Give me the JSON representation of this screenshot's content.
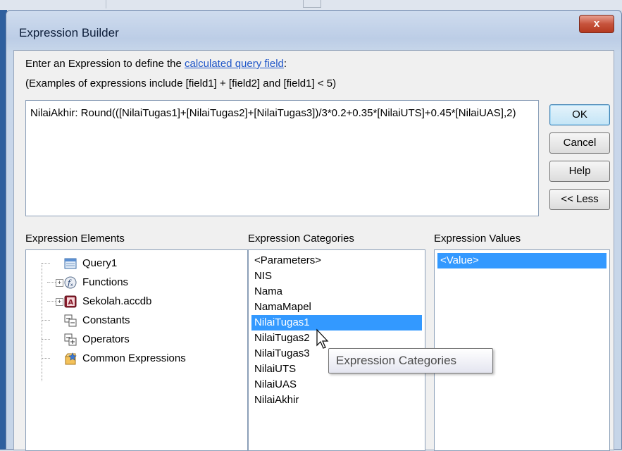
{
  "dialog": {
    "title": "Expression Builder",
    "close_label": "x"
  },
  "prompt": {
    "line1_prefix": "Enter an Expression to define the ",
    "line1_link": "calculated query field",
    "line1_suffix": ":",
    "line2": "(Examples of expressions include [field1] + [field2] and [field1] < 5)"
  },
  "expression": {
    "value": "NilaiAkhir: Round(([NilaiTugas1]+[NilaiTugas2]+[NilaiTugas3])/3*0.2+0.35*[NilaiUTS]+0.45*[NilaiUAS],2)"
  },
  "buttons": {
    "ok": "OK",
    "cancel": "Cancel",
    "help": "Help",
    "less": "<< Less"
  },
  "elements": {
    "label": "Expression Elements",
    "items": [
      {
        "label": "Query1",
        "icon": "query-icon",
        "expandable": false
      },
      {
        "label": "Functions",
        "icon": "function-icon",
        "expandable": true
      },
      {
        "label": "Sekolah.accdb",
        "icon": "database-icon",
        "expandable": true
      },
      {
        "label": "Constants",
        "icon": "constants-icon",
        "expandable": false
      },
      {
        "label": "Operators",
        "icon": "operators-icon",
        "expandable": false
      },
      {
        "label": "Common Expressions",
        "icon": "common-expressions-icon",
        "expandable": false
      }
    ]
  },
  "categories": {
    "label": "Expression Categories",
    "items": [
      "<Parameters>",
      "NIS",
      "Nama",
      "NamaMapel",
      "NilaiTugas1",
      "NilaiTugas2",
      "NilaiTugas3",
      "NilaiUTS",
      "NilaiUAS",
      "NilaiAkhir"
    ],
    "selected": "NilaiTugas1"
  },
  "values": {
    "label": "Expression Values",
    "items": [
      "<Value>"
    ],
    "selected": "<Value>"
  },
  "tooltip": {
    "text": "Expression Categories"
  },
  "colors": {
    "selection": "#3399ff",
    "link": "#1f56c8",
    "close_button": "#c7533c"
  }
}
